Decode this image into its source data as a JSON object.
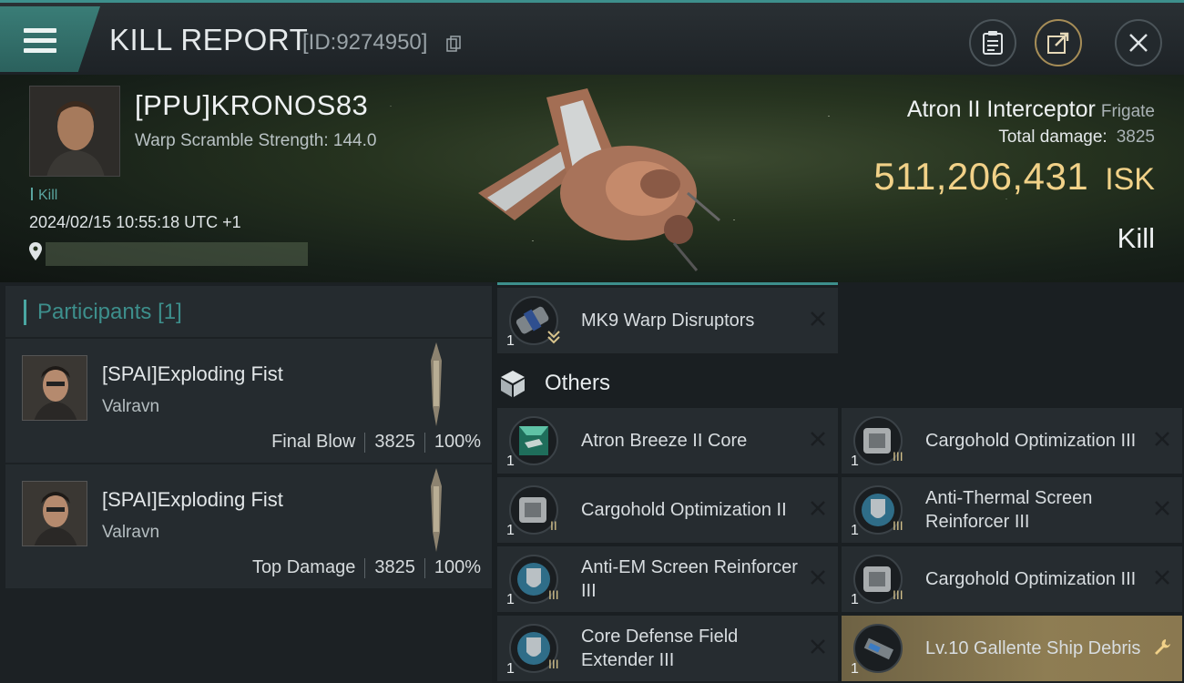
{
  "header": {
    "title": "KILL REPORT",
    "report_id": "[ID:9274950]",
    "buttons": [
      "clipboard-icon",
      "share-icon",
      "close-icon"
    ]
  },
  "victim": {
    "pilot": "[PPU]KRONOS83",
    "warp_scramble": "Warp Scramble Strength: 144.0",
    "tag": "Kill",
    "datetime": "2024/02/15 10:55:18 UTC +1",
    "ship_name": "Atron II Interceptor",
    "ship_class": "Frigate",
    "total_damage_label": "Total damage:",
    "total_damage": "3825",
    "isk_value": "511,206,431",
    "isk_unit": "ISK",
    "result": "Kill"
  },
  "participants": {
    "label": "Participants",
    "count": "[1]",
    "rows": [
      {
        "name": "[SPAI]Exploding Fist",
        "ship": "Valravn",
        "role": "Final Blow",
        "damage": "3825",
        "percent": "100%"
      },
      {
        "name": "[SPAI]Exploding Fist",
        "ship": "Valravn",
        "role": "Top Damage",
        "damage": "3825",
        "percent": "100%"
      }
    ]
  },
  "items": {
    "top": {
      "name": "MK9 Warp Disruptors",
      "qty": "1"
    },
    "others_label": "Others",
    "others": [
      {
        "name": "Atron Breeze II Core",
        "qty": "1",
        "tier": ""
      },
      {
        "name": "Cargohold Optimization III",
        "qty": "1",
        "tier": "III"
      },
      {
        "name": "Cargohold Optimization II",
        "qty": "1",
        "tier": "II"
      },
      {
        "name": "Anti-Thermal Screen Reinforcer III",
        "qty": "1",
        "tier": "III"
      },
      {
        "name": "Anti-EM Screen Reinforcer III",
        "qty": "1",
        "tier": "III"
      },
      {
        "name": "Cargohold Optimization III",
        "qty": "1",
        "tier": "III"
      },
      {
        "name": "Core Defense Field Extender III",
        "qty": "1",
        "tier": "III"
      },
      {
        "name": "Lv.10 Gallente Ship Debris",
        "qty": "1",
        "tier": ""
      }
    ]
  },
  "colors": {
    "accent": "#3d8f8c",
    "isk": "#f1d188",
    "highlight": "#8e7d53"
  }
}
